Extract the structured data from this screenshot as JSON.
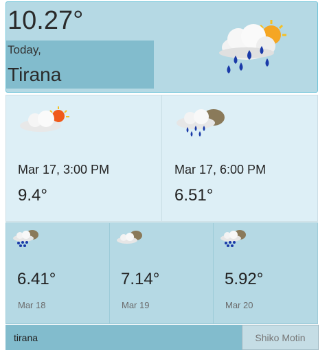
{
  "current": {
    "temp": "10.27°",
    "today_label": "Today,",
    "city": "Tirana",
    "icon": "rain-cloud-sun-icon"
  },
  "hourly": [
    {
      "date": "Mar 17, 3:00 PM",
      "temp": "9.4°",
      "icon": "partly-cloudy-sun-icon"
    },
    {
      "date": "Mar 17, 6:00 PM",
      "temp": "6.51°",
      "icon": "rain-cloud-icon"
    }
  ],
  "daily": [
    {
      "temp": "6.41°",
      "date": "Mar 18",
      "icon": "rain-cloud-icon"
    },
    {
      "temp": "7.14°",
      "date": "Mar 19",
      "icon": "cloudy-icon"
    },
    {
      "temp": "5.92°",
      "date": "Mar 20",
      "icon": "rain-cloud-icon"
    }
  ],
  "search": {
    "value": "tirana",
    "button_label": "Shiko Motin"
  }
}
